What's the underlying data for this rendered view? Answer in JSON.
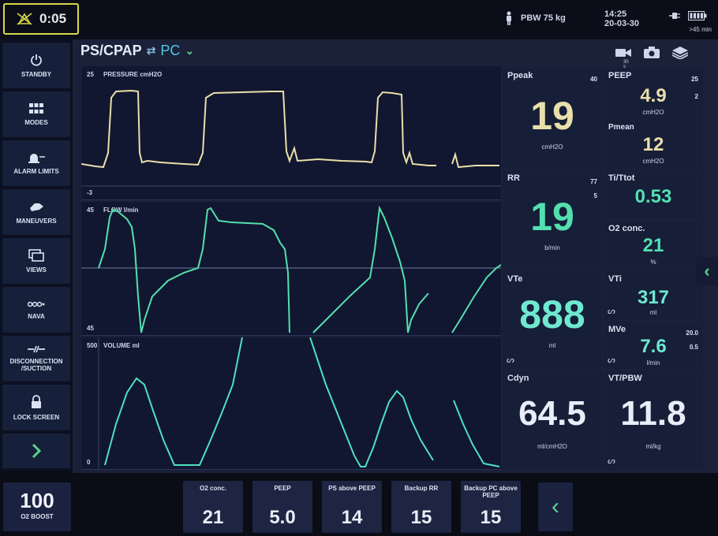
{
  "top_bar": {
    "alarm_timer": "0:05",
    "pbw": "PBW 75 kg",
    "time": "14:25",
    "date": "20-03-30",
    "battery_label": ">45 min"
  },
  "mode": {
    "current": "PS/CPAP",
    "alternate": "PC"
  },
  "sidebar": {
    "items": [
      {
        "label": "STANDBY"
      },
      {
        "label": "MODES"
      },
      {
        "label": "ALARM LIMITS"
      },
      {
        "label": "MANEUVERS"
      },
      {
        "label": "VIEWS"
      },
      {
        "label": "NAVA"
      },
      {
        "label": "DISCONNECTION /SUCTION"
      },
      {
        "label": "LOCK SCREEN"
      }
    ]
  },
  "top_icons": {
    "video_label": "30 s"
  },
  "waveforms": {
    "pressure": {
      "title": "PRESSURE cmH2O",
      "top": "25",
      "bottom": "-3"
    },
    "flow": {
      "title": "FLOW l/min",
      "top": "45",
      "bottom": "45"
    },
    "volume": {
      "title": "VOLUME ml",
      "top": "500",
      "bottom": "0"
    }
  },
  "values": {
    "ppeak": {
      "name": "Ppeak",
      "value": "19",
      "unit": "cmH2O",
      "limit_high": "40"
    },
    "peep": {
      "name": "PEEP",
      "value": "4.9",
      "unit": "cmH2O",
      "limit_high": "25",
      "limit_low": "2"
    },
    "pmean": {
      "name": "Pmean",
      "value": "12",
      "unit": "cmH2O"
    },
    "rr": {
      "name": "RR",
      "value": "19",
      "unit": "b/min",
      "limit_high": "77",
      "limit_low": "5"
    },
    "ti_ttot": {
      "name": "Ti/Ttot",
      "value": "0.53"
    },
    "o2": {
      "name": "O2 conc.",
      "value": "21",
      "unit": "%"
    },
    "vte": {
      "name": "VTe",
      "value": "888",
      "unit": "ml"
    },
    "vti": {
      "name": "VTi",
      "value": "317",
      "unit": "ml"
    },
    "mve": {
      "name": "MVe",
      "value": "7.6",
      "unit": "l/min",
      "limit_high": "20.0",
      "limit_low": "0.5"
    },
    "cdyn": {
      "name": "Cdyn",
      "value": "64.5",
      "unit": "ml/cmH2O"
    },
    "vt_pbw": {
      "name": "VT/PBW",
      "value": "11.8",
      "unit": "ml/kg"
    }
  },
  "bottom": {
    "boost": {
      "value": "100",
      "label": "O2 BOOST"
    },
    "settings": [
      {
        "label": "O2 conc.",
        "value": "21"
      },
      {
        "label": "PEEP",
        "value": "5.0"
      },
      {
        "label": "PS above PEEP",
        "value": "14"
      },
      {
        "label": "Backup RR",
        "value": "15"
      },
      {
        "label": "Backup PC above PEEP",
        "value": "15"
      }
    ]
  },
  "colors": {
    "pressure": "#e9dfaa",
    "flow": "#53e0b0",
    "volume": "#4fe0c0",
    "accent": "#5ad18a"
  }
}
